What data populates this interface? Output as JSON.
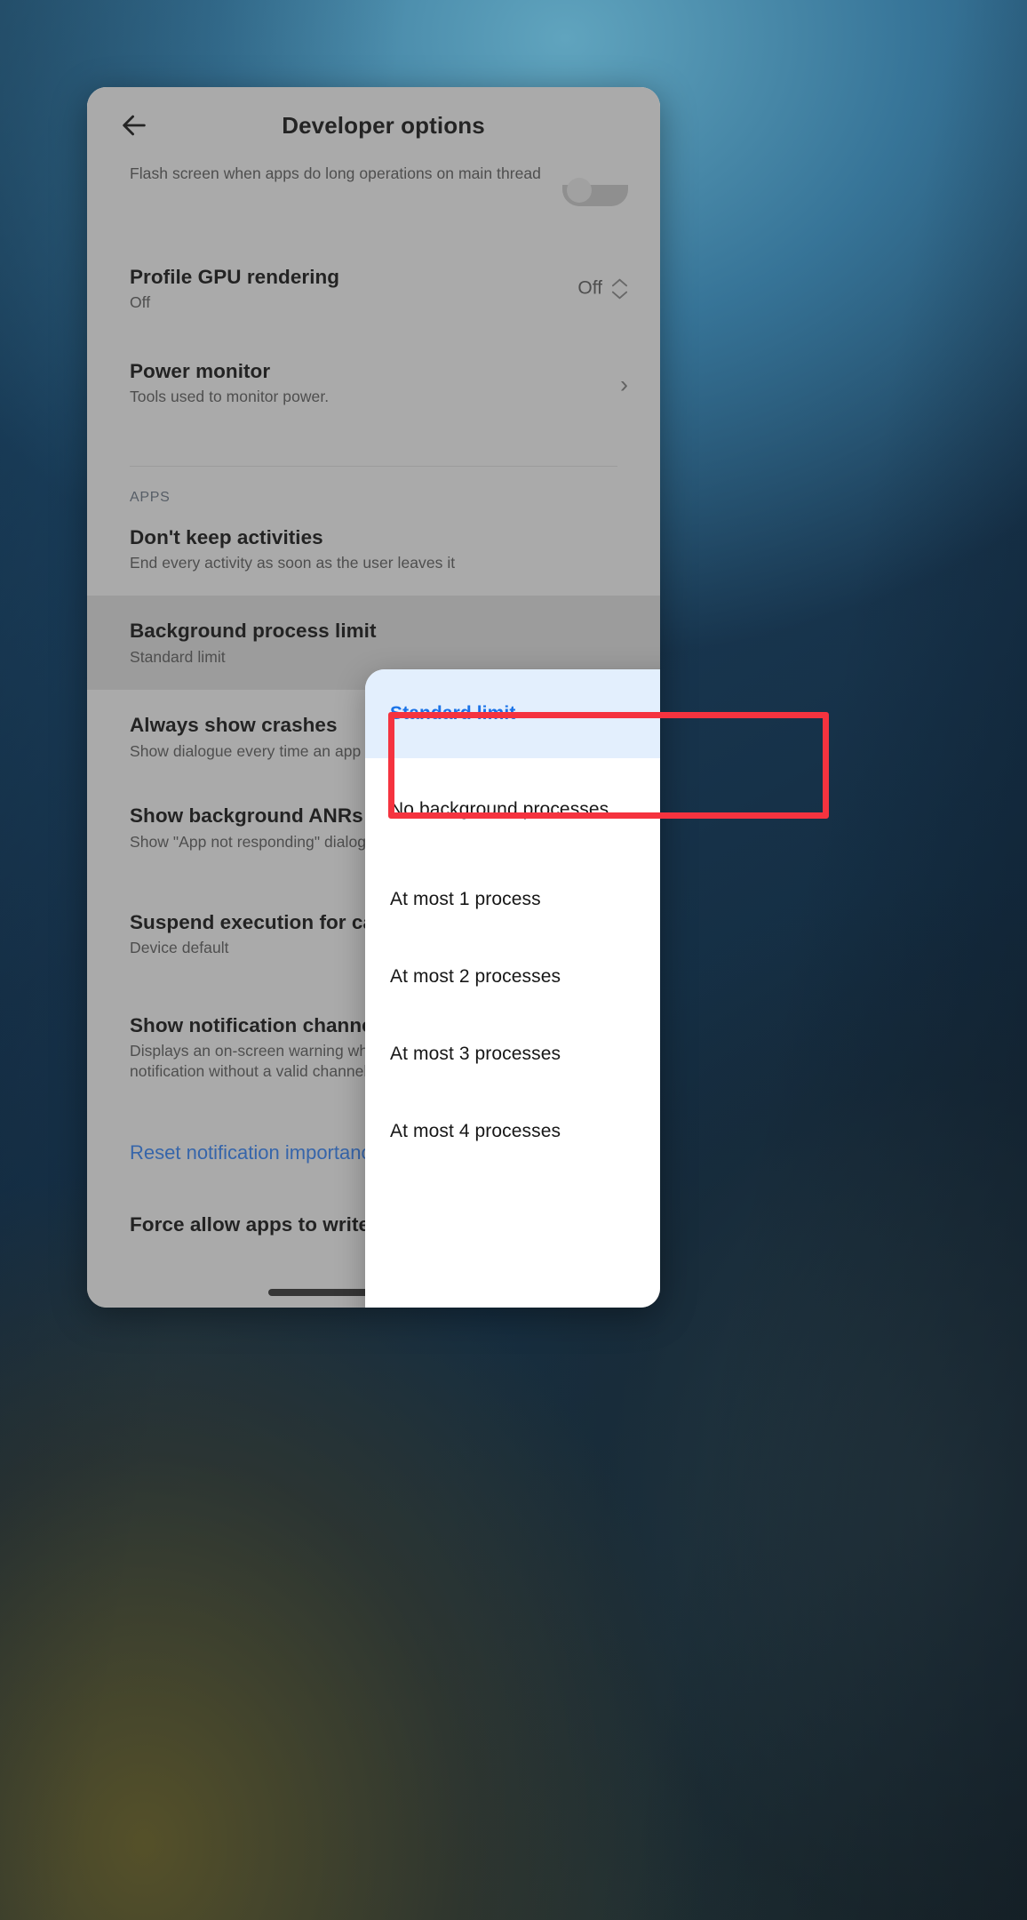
{
  "app": {
    "title": "Developer options",
    "back_icon": "arrow-left-icon"
  },
  "settings_list": {
    "section_label": "APPS",
    "rows": [
      {
        "title": "",
        "subtitle": "Flash screen when apps do long operations on main thread",
        "control": "toggle",
        "toggle_state": "off"
      },
      {
        "title": "Profile GPU rendering",
        "subtitle": "Off",
        "control": "spinner",
        "spinner_value": "Off"
      },
      {
        "title": "Power monitor",
        "subtitle": "Tools used to monitor power.",
        "control": "chevron"
      },
      {
        "title": "Don't keep activities",
        "subtitle": "End every activity as soon as the user leaves it",
        "control": "toggle",
        "toggle_state": "off"
      },
      {
        "title": "Background process limit",
        "subtitle": "Standard limit",
        "control": "none"
      },
      {
        "title": "Always show crashes",
        "subtitle": "Show dialogue every time an app crashes",
        "control": "toggle",
        "toggle_state": "off"
      },
      {
        "title": "Show background ANRs",
        "subtitle": "Show \"App not responding\" dialog for background apps",
        "control": "toggle",
        "toggle_state": "off"
      },
      {
        "title": "Suspend execution for cached apps",
        "subtitle": "Device default",
        "control": "chevron"
      },
      {
        "title": "Show notification channel warnings",
        "subtitle": "Displays an on-screen warning when an app posts a notification without a valid channel",
        "control": "toggle",
        "toggle_state": "off"
      },
      {
        "title": "Reset notification importance",
        "subtitle": "",
        "control": "link"
      },
      {
        "title": "Force allow apps to write on external stor",
        "subtitle": "",
        "control": "none"
      }
    ]
  },
  "dialog": {
    "options": [
      {
        "label": "Standard limit",
        "selected": true,
        "check_icon": "check-icon"
      },
      {
        "label": "No background processes",
        "selected": false
      },
      {
        "label": "At most 1 process",
        "selected": false
      },
      {
        "label": "At most 2 processes",
        "selected": false
      },
      {
        "label": "At most 3 processes",
        "selected": false
      },
      {
        "label": "At most 4 processes",
        "selected": false
      }
    ]
  },
  "annotation": {
    "target": "No background processes",
    "color": "#f5333f"
  },
  "colors": {
    "accent_blue": "#1a73e8",
    "link_blue": "#2c6fd1",
    "selected_row_bg": "#e3effd",
    "annotation_red": "#f5333f",
    "surface_gray": "#d2d2d2"
  }
}
